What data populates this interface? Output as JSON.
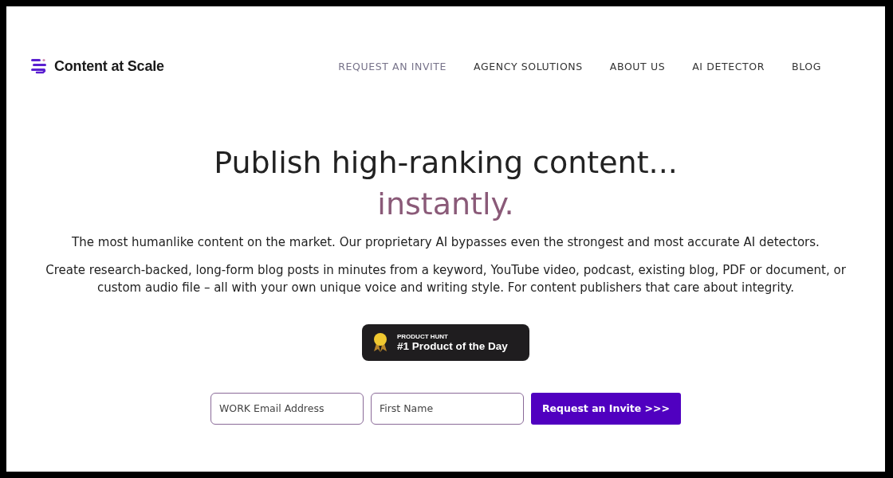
{
  "logo": {
    "text": "Content at Scale"
  },
  "nav": [
    {
      "label": "REQUEST AN INVITE",
      "selected": true
    },
    {
      "label": "AGENCY SOLUTIONS",
      "selected": false
    },
    {
      "label": "ABOUT US",
      "selected": false
    },
    {
      "label": "AI DETECTOR",
      "selected": false
    },
    {
      "label": "BLOG",
      "selected": false
    }
  ],
  "hero": {
    "headline": "Publish high-ranking content...",
    "accent": "instantly.",
    "lead": "The most humanlike content on the market. Our proprietary AI bypasses even the strongest and most accurate AI detectors.",
    "body": "Create research-backed, long-form blog posts in minutes from a keyword, YouTube video, podcast, existing blog, PDF or document, or custom audio file – all with your own unique voice and writing style. For content publishers that care about integrity."
  },
  "badge": {
    "eyebrow": "PRODUCT HUNT",
    "title": "#1 Product of the Day"
  },
  "form": {
    "fields": [
      {
        "placeholder": "WORK Email Address"
      },
      {
        "placeholder": "First Name"
      }
    ],
    "button": "Request an Invite >>>"
  }
}
